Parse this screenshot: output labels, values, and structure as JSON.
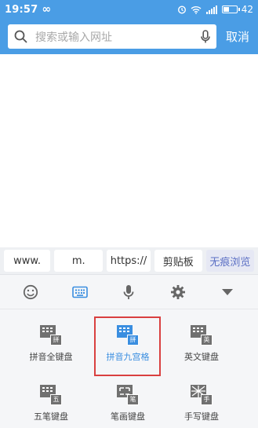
{
  "status_bar": {
    "time": "19:57",
    "infinity": "∞",
    "battery": "42",
    "battery_level": 0.42
  },
  "header": {
    "search_placeholder": "搜索或输入网址",
    "cancel_label": "取消"
  },
  "suggestions": [
    {
      "label": "www."
    },
    {
      "label": "m."
    },
    {
      "label": "https://"
    },
    {
      "label": "剪贴板"
    },
    {
      "label": "无痕浏览"
    }
  ],
  "ime_toolbar": {
    "icons": [
      "emoji-icon",
      "keyboard-icon",
      "microphone-icon",
      "settings-icon",
      "collapse-icon"
    ]
  },
  "keyboards": [
    {
      "label": "拼音全键盘",
      "badge": "拼",
      "active": false
    },
    {
      "label": "拼音九宫格",
      "badge": "拼",
      "active": true
    },
    {
      "label": "英文键盘",
      "badge": "英",
      "active": false
    },
    {
      "label": "五笔键盘",
      "badge": "五",
      "active": false
    },
    {
      "label": "笔画键盘",
      "badge": "笔",
      "active": false
    },
    {
      "label": "手写键盘",
      "badge": "手",
      "active": false
    }
  ],
  "colors": {
    "accent": "#4a9de5",
    "highlight": "#d94040",
    "active_blue": "#3a8ee0",
    "icon_gray": "#666666"
  }
}
